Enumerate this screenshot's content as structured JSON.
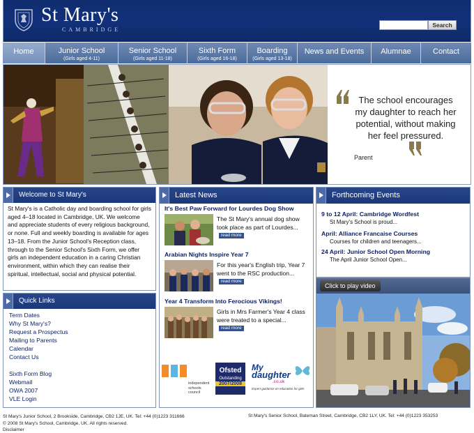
{
  "header": {
    "school_name": "St Mary's",
    "city": "CAMBRIDGE",
    "search_placeholder": "",
    "search_label": "Search"
  },
  "nav": [
    {
      "label": "Home",
      "sub": ""
    },
    {
      "label": "Junior School",
      "sub": "(Girls aged 4-11)"
    },
    {
      "label": "Senior School",
      "sub": "(Girls aged 11-18)"
    },
    {
      "label": "Sixth Form",
      "sub": "(Girls aged 16-18)"
    },
    {
      "label": "Boarding",
      "sub": "(Girls aged 13-18)"
    },
    {
      "label": "News and Events",
      "sub": ""
    },
    {
      "label": "Alumnae",
      "sub": ""
    },
    {
      "label": "Contact",
      "sub": ""
    }
  ],
  "hero": {
    "quote": "The school encourages my daughter to reach her potential, without making her feel pressured.",
    "attribution": "Parent"
  },
  "welcome": {
    "heading": "Welcome to St Mary's",
    "text": "St Mary's is a Catholic day and boarding school for girls aged 4–18 located in Cambridge, UK. We welcome and appreciate students of every religious background, or none. Full and weekly boarding is available for ages 13–18. From the Junior School's Reception class, through to the Senior School's Sixth Form, we offer girls an independent education in a caring Christian environment, within which they can realise their spiritual, intellectual, social and physical potential."
  },
  "quick_links": {
    "heading": "Quick Links",
    "group1": [
      "Term Dates",
      "Why St Mary's?",
      "Request a Prospectus",
      "Mailing to Parents",
      "Calendar",
      "Contact Us"
    ],
    "group2": [
      "Sixth Form Blog",
      "Webmail",
      "OWA 2007",
      "VLE Login"
    ]
  },
  "news": {
    "heading": "Latest News",
    "read_more": "read more",
    "items": [
      {
        "title": "It's Best Paw Forward for Lourdes Dog Show",
        "excerpt": "The St Mary's annual dog show took place as part of Lourdes..."
      },
      {
        "title": "Arabian Nights Inspire Year 7",
        "excerpt": "For this year's English trip, Year 7 went to the RSC production..."
      },
      {
        "title": "Year 4 Transform Into Ferocious Vikings!",
        "excerpt": "Girls in Mrs Farmer's Year 4 class were treated to a special..."
      }
    ],
    "logos": {
      "isc": "independent schools council",
      "ofsted_name": "Ofsted",
      "ofsted_status": "Outstanding",
      "ofsted_years": "2007/2008",
      "mydaughter_1": "My",
      "mydaughter_2": "daughter",
      "mydaughter_domain": ".co.uk",
      "mydaughter_tagline": "Expert guidance on education for girls"
    }
  },
  "events": {
    "heading": "Forthcoming Events",
    "items": [
      {
        "title": "9 to 12 April: Cambridge Wordfest",
        "sub": "St Mary's School is proud..."
      },
      {
        "title": "April: Alliance Francaise Courses",
        "sub": "Courses for children and teenagers..."
      },
      {
        "title": "24 April: Junior School Open Morning",
        "sub": "The April Junior School Open..."
      }
    ]
  },
  "video": {
    "label": "Click to play video"
  },
  "footer": {
    "junior_address": "St Mary's Junior School, 2 Brookside, Cambridge, CB2 1JE, UK. Tel: +44 (0)1223 311666",
    "copyright": "© 2008 St Mary's School, Cambridge, UK. All rights reserved.",
    "disclaimer": "Disclaimer",
    "senior_address": "St Mary's Senior School, Bateman Street, Cambridge, CB2 1LY, UK. Tel: +44 (0)1223 353253"
  },
  "colors": {
    "brand_navy": "#12317a",
    "nav_blue": "#5a78a8",
    "link": "#0b1f63",
    "quote_gold": "#8a7a4a"
  }
}
